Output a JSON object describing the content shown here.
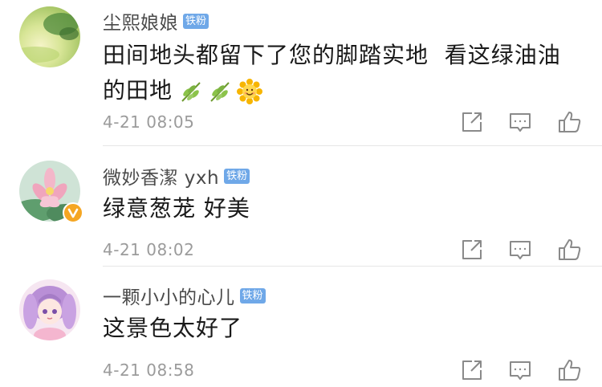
{
  "comments": [
    {
      "username": "尘熙娘娘",
      "badge": "铁粉",
      "text": "田间地头都留下了您的脚踏实地  看这绿油油的田地",
      "emojis": [
        "leaf-emoji",
        "leaf-emoji",
        "smiling-sunflower-emoji"
      ],
      "time": "4-21 08:05",
      "verified": false
    },
    {
      "username": "微妙香潔 yxh",
      "badge": "铁粉",
      "text": "绿意葱茏 好美",
      "emojis": [],
      "time": "4-21 08:02",
      "verified": true
    },
    {
      "username": "一颗小小的心儿",
      "badge": "铁粉",
      "text": "这景色太好了",
      "emojis": [],
      "time": "4-21 08:58",
      "verified": false
    }
  ],
  "icons": {
    "share": "share-icon",
    "reply": "comment-icon",
    "like": "thumbs-up-icon"
  },
  "colors": {
    "badge": "#6fa8e8",
    "verified": "#f5a623",
    "timestamp": "#9b9b9b",
    "icon": "#8a8a8a"
  }
}
